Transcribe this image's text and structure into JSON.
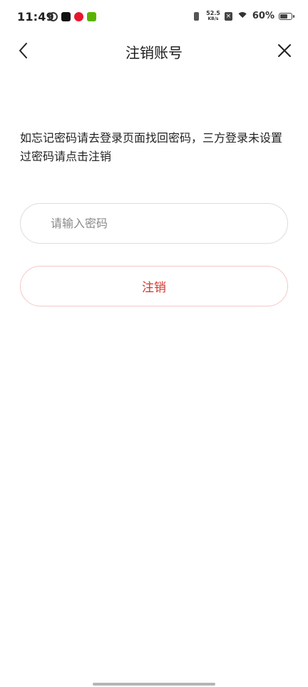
{
  "status_bar": {
    "time": "11:49",
    "net_speed_value": "52.5",
    "net_speed_unit": "KB/s",
    "battery_percent": "60%",
    "notification_icons": [
      "cloud-icon",
      "tiktok-icon",
      "weibo-icon",
      "game-icon"
    ]
  },
  "nav": {
    "title": "注销账号",
    "back_icon": "chevron-left-icon",
    "close_icon": "close-icon"
  },
  "content": {
    "hint_text": "如忘记密码请去登录页面找回密码，三方登录未设置过密码请点击注销",
    "password_placeholder": "请输入密码",
    "password_value": "",
    "submit_label": "注销"
  },
  "colors": {
    "accent": "#d0382e",
    "button_border": "#f3c9c6",
    "input_border": "#dcdcdc"
  }
}
